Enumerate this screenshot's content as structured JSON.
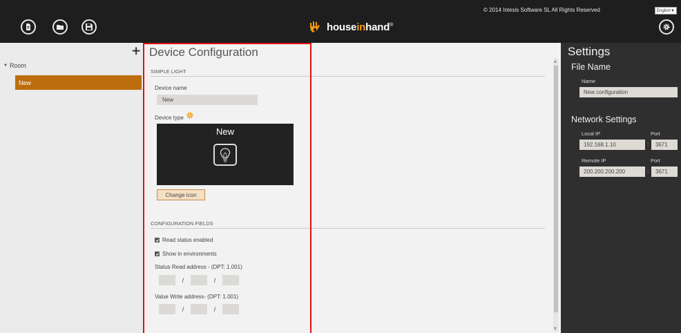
{
  "toolbar": {
    "new_file_icon": "file-icon",
    "open_folder_icon": "folder-icon",
    "save_icon": "save-icon",
    "settings_icon": "gear-icon"
  },
  "brand": {
    "name_part1": "house",
    "name_part2": "in",
    "name_part3": "hand",
    "trademark": "®",
    "accent_color": "#f39c12"
  },
  "header": {
    "copyright": "© 2014 Intesis Software SL All Rights Reserved",
    "language": "English"
  },
  "tree": {
    "add_label": "+",
    "room_label": "Room",
    "selected_item": "New",
    "selected_color": "#bd6d0c"
  },
  "config": {
    "title": "Device Configuration",
    "section_device": "SIMPLE LIGHT",
    "device_name_label": "Device name",
    "device_name_value": "New",
    "device_type_label": "Device type",
    "preview_name": "New",
    "change_icon_label": "Change icon",
    "section_fields": "CONFIGURATION FIELDS",
    "read_status_label": "Read status enabled",
    "read_status_checked": true,
    "show_env_label": "Show in environments",
    "show_env_checked": true,
    "status_read_label": "Status Read address - (DPT: 1.001)",
    "value_write_label": "Value Write address- (DPT: 1.001)",
    "addr_sep": "/"
  },
  "settings": {
    "title": "Settings",
    "file_name_heading": "File Name",
    "name_label": "Name",
    "name_value": "New configuration",
    "network_heading": "Network Settings",
    "local_ip_label": "Local IP",
    "local_ip_value": "192.168.1.10",
    "local_port_label": "Port",
    "local_port_value": "3671",
    "remote_ip_label": "Remote IP",
    "remote_ip_value": "200.200.200.200",
    "remote_port_label": "Port",
    "remote_port_value": "3671",
    "colon": ":"
  }
}
